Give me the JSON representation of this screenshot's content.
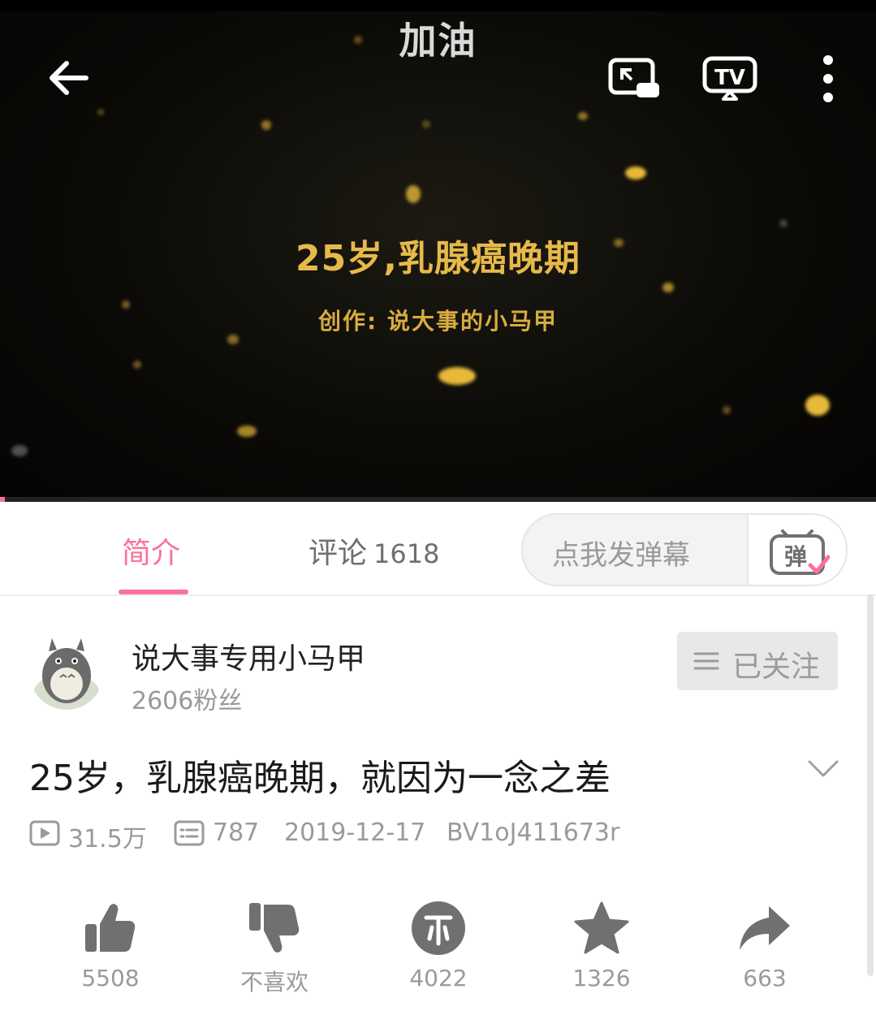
{
  "player": {
    "title": "加油",
    "headline": "25岁,乳腺癌晚期",
    "credit": "创作: 说大事的小马甲",
    "icons": [
      "back-arrow-icon",
      "picture-in-picture-icon",
      "tv-cast-icon",
      "more-vertical-icon"
    ],
    "progress": 0.005
  },
  "tabs": {
    "intro": "简介",
    "comments": "评论",
    "comments_count": "1618"
  },
  "danmaku": {
    "placeholder": "点我发弹幕",
    "icon_char": "弹"
  },
  "author": {
    "name": "说大事专用小马甲",
    "fans": "2606粉丝",
    "follow_label": "已关注"
  },
  "video": {
    "title": "25岁，乳腺癌晚期，就因为一念之差",
    "views": "31.5万",
    "danmaku_count": "787",
    "date": "2019-12-17",
    "bvid": "BV1oJ411673r"
  },
  "actions": {
    "like": "5508",
    "dislike": "不喜欢",
    "coin": "4022",
    "favorite": "1326",
    "share": "663"
  },
  "colors": {
    "accent": "#fb7299",
    "headline_gold": "#e6b94a",
    "player_bg": "#0b0a07",
    "icon_gray": "#707070"
  }
}
